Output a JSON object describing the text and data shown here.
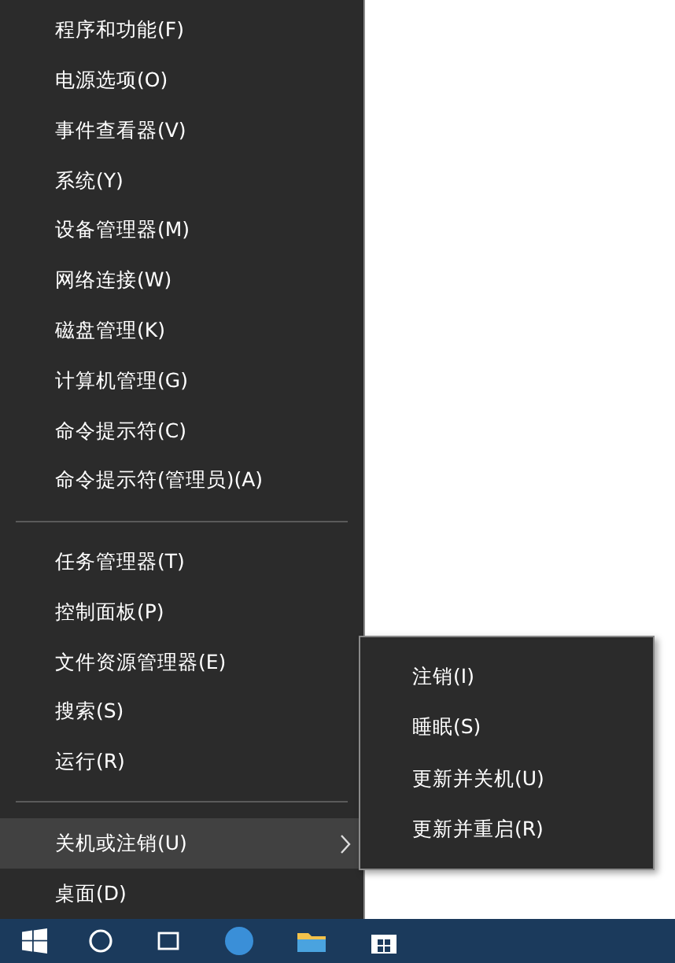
{
  "menu": {
    "sections": [
      [
        {
          "label": "程序和功能(F)",
          "selected": false,
          "kind": "plain"
        },
        {
          "label": "电源选项(O)",
          "selected": false,
          "kind": "plain"
        },
        {
          "label": "事件查看器(V)",
          "selected": false,
          "kind": "plain"
        },
        {
          "label": "系统(Y)",
          "selected": false,
          "kind": "plain"
        },
        {
          "label": "设备管理器(M)",
          "selected": false,
          "kind": "plain"
        },
        {
          "label": "网络连接(W)",
          "selected": false,
          "kind": "plain"
        },
        {
          "label": "磁盘管理(K)",
          "selected": false,
          "kind": "plain"
        },
        {
          "label": "计算机管理(G)",
          "selected": false,
          "kind": "plain"
        },
        {
          "label": "命令提示符(C)",
          "selected": false,
          "kind": "plain"
        },
        {
          "label": "命令提示符(管理员)(A)",
          "selected": false,
          "kind": "plain"
        }
      ],
      [
        {
          "label": "任务管理器(T)",
          "selected": false,
          "kind": "plain"
        },
        {
          "label": "控制面板(P)",
          "selected": false,
          "kind": "plain"
        },
        {
          "label": "文件资源管理器(E)",
          "selected": false,
          "kind": "plain"
        },
        {
          "label": "搜索(S)",
          "selected": false,
          "kind": "plain"
        },
        {
          "label": "运行(R)",
          "selected": false,
          "kind": "plain"
        }
      ],
      [
        {
          "label": "关机或注销(U)",
          "selected": true,
          "kind": "submenu"
        },
        {
          "label": "桌面(D)",
          "selected": false,
          "kind": "plain"
        }
      ]
    ]
  },
  "submenu": {
    "items": [
      {
        "label": "注销(I)",
        "selected": false
      },
      {
        "label": "睡眠(S)",
        "selected": false
      },
      {
        "label": "更新并关机(U)",
        "selected": false
      },
      {
        "label": "更新并重启(R)",
        "selected": false
      }
    ]
  }
}
